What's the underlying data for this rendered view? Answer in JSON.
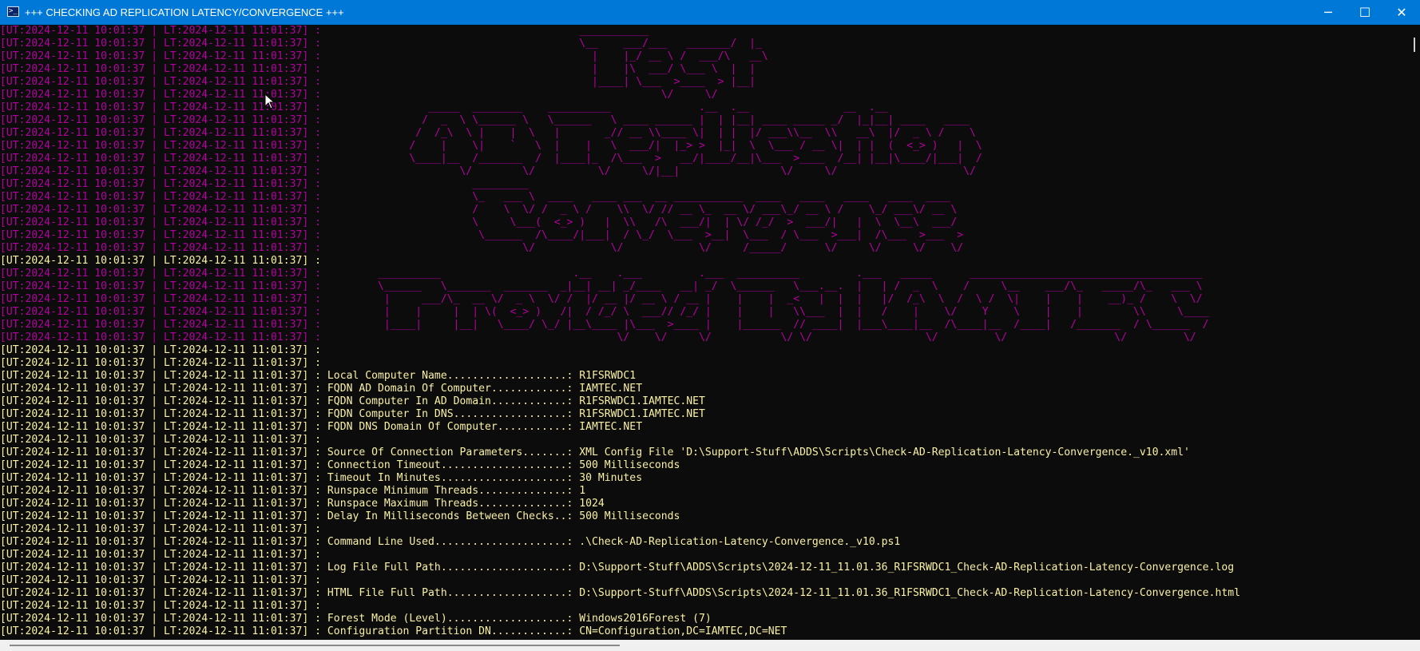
{
  "window": {
    "title": "+++ CHECKING AD REPLICATION LATENCY/CONVERGENCE +++",
    "icon": "powershell-icon",
    "icon_glyph": ">_",
    "minimize_glyph": "─",
    "maximize_glyph": "☐",
    "close_glyph": "✕"
  },
  "colors": {
    "title_bar": "#0078d7",
    "terminal_bg": "#0c0c0c",
    "banner_magenta": "#b4009e",
    "highlight_yellow": "#f9f1a5",
    "text": "#eeedf0"
  },
  "terminal": {
    "lines": [
      {
        "style": "magenta",
        "text": "[UT:2024-12-11 10:01:37 | LT:2024-12-11 11:01:37] :                                         ___________               "
      },
      {
        "style": "magenta",
        "text": "[UT:2024-12-11 10:01:37 | LT:2024-12-11 11:01:37] :                                         \\__    ___/___   _______/  |_   "
      },
      {
        "style": "magenta",
        "text": "[UT:2024-12-11 10:01:37 | LT:2024-12-11 11:01:37] :                                           |    |_/ __ \\ /  ___/\\   __\\  "
      },
      {
        "style": "magenta",
        "text": "[UT:2024-12-11 10:01:37 | LT:2024-12-11 11:01:37] :                                           |    |\\  ___/ \\___ \\  |  |    "
      },
      {
        "style": "magenta",
        "text": "[UT:2024-12-11 10:01:37 | LT:2024-12-11 11:01:37] :                                           |____| \\___  >____  > |__|    "
      },
      {
        "style": "magenta",
        "text": "[UT:2024-12-11 10:01:37 | LT:2024-12-11 11:01:37] :                                                      \\/     \\/           "
      },
      {
        "style": "magenta",
        "text": "[UT:2024-12-11 10:01:37 | LT:2024-12-11 11:01:37] :                 _____  ________    __________              .__  .__               __  .__               "
      },
      {
        "style": "magenta",
        "text": "[UT:2024-12-11 10:01:37 | LT:2024-12-11 11:01:37] :                /  _  \\ \\______ \\   \\______   \\ ____ ______ |  | |__| ____ _____ _/  |_|__| ____   ____  "
      },
      {
        "style": "magenta",
        "text": "[UT:2024-12-11 10:01:37 | LT:2024-12-11 11:01:37] :               /  /_\\  \\ |    |  \\   |       _// __ \\\\____ \\|  | |  |/ ___\\\\__  \\\\   __\\  |/  _ \\ /    \\ "
      },
      {
        "style": "magenta",
        "text": "[UT:2024-12-11 10:01:37 | LT:2024-12-11 11:01:37] :              /    |    \\|    `   \\  |    |   \\  ___/|  |_> >  |_|  \\  \\___ / __ \\|  | |  (  <_> )   |  \\"
      },
      {
        "style": "magenta",
        "text": "[UT:2024-12-11 10:01:37 | LT:2024-12-11 11:01:37] :              \\____|__  /_______  /  |____|_  /\\___  >   __/|____/__|\\___  >____  /__| |__|\\____/|___|  /"
      },
      {
        "style": "magenta",
        "text": "[UT:2024-12-11 10:01:37 | LT:2024-12-11 11:01:37] :                      \\/        \\/          \\/     \\/|__|                \\/     \\/                    \\/ "
      },
      {
        "style": "magenta",
        "text": "[UT:2024-12-11 10:01:37 | LT:2024-12-11 11:01:37] :                        _________                                                                  "
      },
      {
        "style": "magenta",
        "text": "[UT:2024-12-11 10:01:37 | LT:2024-12-11 11:01:37] :                        \\_   ___ \\  ____   ____ ___  __ ___________  ____   ____   ____   ____  ____ "
      },
      {
        "style": "magenta",
        "text": "[UT:2024-12-11 10:01:37 | LT:2024-12-11 11:01:37] :                        /    \\  \\/ /  _ \\ /    \\\\  \\/ // __ \\_  __ \\/ ___\\_/ __ \\ /    \\_/ ___\\/ __ \\"
      },
      {
        "style": "magenta",
        "text": "[UT:2024-12-11 10:01:37 | LT:2024-12-11 11:01:37] :                        \\     \\___(  <_> )   |  \\\\   /\\  ___/|  | \\/ /_/  >  ___/|   |  \\  \\__\\  ___/"
      },
      {
        "style": "magenta",
        "text": "[UT:2024-12-11 10:01:37 | LT:2024-12-11 11:01:37] :                         \\______  /\\____/|___|  / \\_/  \\___  >__|  \\___  / \\___  >___|  /\\___  >___  >"
      },
      {
        "style": "magenta",
        "text": "[UT:2024-12-11 10:01:37 | LT:2024-12-11 11:01:37] :                                \\/            \\/            \\/     /_____/      \\/     \\/     \\/    \\/ "
      },
      {
        "style": "yellow",
        "text": "[UT:2024-12-11 10:01:37 | LT:2024-12-11 11:01:37] :"
      },
      {
        "style": "magenta",
        "text": "[UT:2024-12-11 10:01:37 | LT:2024-12-11 11:01:37] :         __________                     .__    .___         .___  __________         .___   _____      _____________________________________  "
      },
      {
        "style": "magenta",
        "text": "[UT:2024-12-11 10:01:37 | LT:2024-12-11 11:01:37] :         \\______   \\_______  _______  _|__| __| _/____   __| _/  \\______   \\___.__.  |   | /  _  \\    /     \\__    ___/\\_   _____/\\_   ___ \\ "
      },
      {
        "style": "magenta",
        "text": "[UT:2024-12-11 10:01:37 | LT:2024-12-11 11:01:37] :          |     ___/\\_  __ \\/  _ \\  \\/ /  |/ __ |/ __ \\ / __ |    |    |  _<   |  |  |   |/  /_\\  \\  /  \\ /  \\|    |    |    __)_ /    \\  \\/ "
      },
      {
        "style": "magenta",
        "text": "[UT:2024-12-11 10:01:37 | LT:2024-12-11 11:01:37] :          |    |     |  | \\(  <_> )   /|  / /_/ \\  ___// /_/ |    |    |   \\\\___  |  |   /    |    \\/    Y    \\    |    |        \\\\     \\____"
      },
      {
        "style": "magenta",
        "text": "[UT:2024-12-11 10:01:37 | LT:2024-12-11 11:01:37] :          |____|     |__|   \\____/ \\_/ |__\\____ |\\___  >____ |    |______  // ____|  |___\\____|__  /\\____|__  /____|   /_______  / \\______  /"
      },
      {
        "style": "magenta",
        "text": "[UT:2024-12-11 10:01:37 | LT:2024-12-11 11:01:37] :                                               \\/    \\/     \\/           \\/ \\/                  \\/         \\/                 \\/         \\/ "
      },
      {
        "style": "yellow",
        "text": "[UT:2024-12-11 10:01:37 | LT:2024-12-11 11:01:37] :"
      },
      {
        "style": "yellow",
        "text": "[UT:2024-12-11 10:01:37 | LT:2024-12-11 11:01:37] :"
      },
      {
        "style": "yellow",
        "text": "[UT:2024-12-11 10:01:37 | LT:2024-12-11 11:01:37] : Local Computer Name...................: R1FSRWDC1"
      },
      {
        "style": "yellow",
        "text": "[UT:2024-12-11 10:01:37 | LT:2024-12-11 11:01:37] : FQDN AD Domain Of Computer............: IAMTEC.NET"
      },
      {
        "style": "yellow",
        "text": "[UT:2024-12-11 10:01:37 | LT:2024-12-11 11:01:37] : FQDN Computer In AD Domain............: R1FSRWDC1.IAMTEC.NET"
      },
      {
        "style": "yellow",
        "text": "[UT:2024-12-11 10:01:37 | LT:2024-12-11 11:01:37] : FQDN Computer In DNS..................: R1FSRWDC1.IAMTEC.NET"
      },
      {
        "style": "yellow",
        "text": "[UT:2024-12-11 10:01:37 | LT:2024-12-11 11:01:37] : FQDN DNS Domain Of Computer...........: IAMTEC.NET"
      },
      {
        "style": "yellow",
        "text": "[UT:2024-12-11 10:01:37 | LT:2024-12-11 11:01:37] :"
      },
      {
        "style": "yellow",
        "text": "[UT:2024-12-11 10:01:37 | LT:2024-12-11 11:01:37] : Source Of Connection Parameters.......: XML Config File 'D:\\Support-Stuff\\ADDS\\Scripts\\Check-AD-Replication-Latency-Convergence._v10.xml'"
      },
      {
        "style": "yellow",
        "text": "[UT:2024-12-11 10:01:37 | LT:2024-12-11 11:01:37] : Connection Timeout....................: 500 Milliseconds"
      },
      {
        "style": "yellow",
        "text": "[UT:2024-12-11 10:01:37 | LT:2024-12-11 11:01:37] : Timeout In Minutes....................: 30 Minutes"
      },
      {
        "style": "yellow",
        "text": "[UT:2024-12-11 10:01:37 | LT:2024-12-11 11:01:37] : Runspace Minimum Threads..............: 1"
      },
      {
        "style": "yellow",
        "text": "[UT:2024-12-11 10:01:37 | LT:2024-12-11 11:01:37] : Runspace Maximum Threads..............: 1024"
      },
      {
        "style": "yellow",
        "text": "[UT:2024-12-11 10:01:37 | LT:2024-12-11 11:01:37] : Delay In Milliseconds Between Checks..: 500 Milliseconds"
      },
      {
        "style": "yellow",
        "text": "[UT:2024-12-11 10:01:37 | LT:2024-12-11 11:01:37] :"
      },
      {
        "style": "yellow",
        "text": "[UT:2024-12-11 10:01:37 | LT:2024-12-11 11:01:37] : Command Line Used.....................: .\\Check-AD-Replication-Latency-Convergence._v10.ps1"
      },
      {
        "style": "yellow",
        "text": "[UT:2024-12-11 10:01:37 | LT:2024-12-11 11:01:37] :"
      },
      {
        "style": "yellow",
        "text": "[UT:2024-12-11 10:01:37 | LT:2024-12-11 11:01:37] : Log File Full Path....................: D:\\Support-Stuff\\ADDS\\Scripts\\2024-12-11_11.01.36_R1FSRWDC1_Check-AD-Replication-Latency-Convergence.log"
      },
      {
        "style": "yellow",
        "text": "[UT:2024-12-11 10:01:37 | LT:2024-12-11 11:01:37] :"
      },
      {
        "style": "yellow",
        "text": "[UT:2024-12-11 10:01:37 | LT:2024-12-11 11:01:37] : HTML File Full Path...................: D:\\Support-Stuff\\ADDS\\Scripts\\2024-12-11_11.01.36_R1FSRWDC1_Check-AD-Replication-Latency-Convergence.html"
      },
      {
        "style": "yellow",
        "text": "[UT:2024-12-11 10:01:37 | LT:2024-12-11 11:01:37] :"
      },
      {
        "style": "yellow",
        "text": "[UT:2024-12-11 10:01:37 | LT:2024-12-11 11:01:37] : Forest Mode (Level)...................: Windows2016Forest (7)"
      },
      {
        "style": "yellow",
        "text": "[UT:2024-12-11 10:01:37 | LT:2024-12-11 11:01:37] : Configuration Partition DN............: CN=Configuration,DC=IAMTEC,DC=NET"
      }
    ]
  }
}
